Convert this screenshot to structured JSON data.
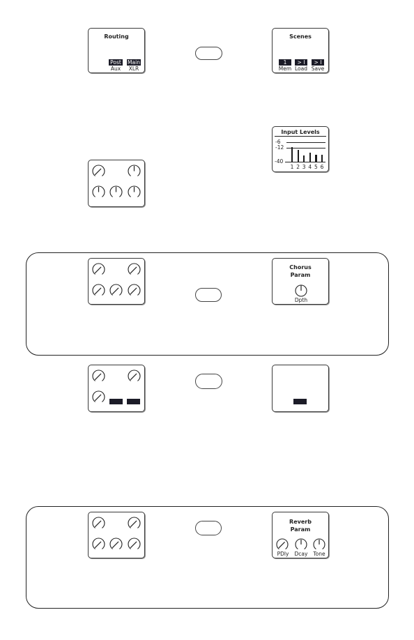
{
  "routing": {
    "title": "Routing",
    "buttons": [
      {
        "value": "Post",
        "label": "Aux"
      },
      {
        "value": "Main",
        "label": "XLR"
      }
    ]
  },
  "scenes": {
    "title": "Scenes",
    "buttons": [
      {
        "value": "1",
        "label": "Mem"
      },
      {
        "value": "> I",
        "label": "Load"
      },
      {
        "value": "> I",
        "label": "Save"
      }
    ]
  },
  "input_levels": {
    "title": "Input Levels",
    "scale_labels": [
      "-6",
      "-12",
      "-40"
    ],
    "channels": [
      "1",
      "2",
      "3",
      "4",
      "5",
      "6"
    ],
    "levels": [
      0.78,
      0.62,
      0.32,
      0.5,
      0.38,
      0.38
    ]
  },
  "knob_panels": {
    "panel_a": {
      "knobs": [
        "angled",
        "up",
        "up",
        "up",
        "up"
      ]
    },
    "panel_b": {
      "knobs": [
        "angled",
        "angled",
        "angled",
        "angled",
        "angled"
      ]
    },
    "panel_c": {
      "knobs": [
        "angled",
        "angled",
        "angled"
      ],
      "blocks": 2
    },
    "panel_d": {
      "knobs": [
        "angled",
        "angled",
        "angled",
        "angled",
        "angled"
      ]
    }
  },
  "chorus": {
    "title_line1": "Chorus",
    "title_line2": "Param",
    "knobs": [
      {
        "label": "Dpth",
        "position": "up"
      }
    ]
  },
  "blank_display": {
    "blocks": 1
  },
  "reverb": {
    "title_line1": "Reverb",
    "title_line2": "Param",
    "knobs": [
      {
        "label": "PDly",
        "position": "angled"
      },
      {
        "label": "Dcay",
        "position": "up"
      },
      {
        "label": "Tone",
        "position": "up"
      }
    ]
  },
  "icons": {
    "knob": "knob-icon",
    "pill_button": "rounded-button"
  }
}
